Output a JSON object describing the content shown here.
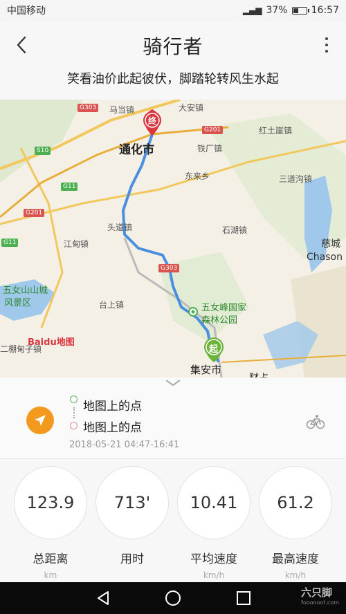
{
  "status_bar": {
    "carrier": "中国移动",
    "battery_percent_text": "37%",
    "battery_level": 0.37,
    "time": "16:57"
  },
  "header": {
    "title": "骑行者",
    "subtitle": "笑看油价此起彼伏，脚踏轮转风生水起"
  },
  "map": {
    "places": [
      "马当镇",
      "大安镇",
      "通化市",
      "铁厂镇",
      "红土崖镇",
      "东来乡",
      "三道沟镇",
      "头道镇",
      "石湖镇",
      "江甸镇",
      "慈城",
      "Chason",
      "五女山山城",
      "风景区",
      "台上镇",
      "五女峰国家",
      "森林公园",
      "二棚甸子镇",
      "集安市",
      "财占"
    ],
    "roads": [
      "G303",
      "G201",
      "S10",
      "G11",
      "G201",
      "G11",
      "G303"
    ],
    "start_marker": "起",
    "end_marker": "终",
    "provider_logo": "Baidu地图",
    "route_color": "#4a8fe0"
  },
  "route": {
    "start_label": "地图上的点",
    "end_label": "地图上的点",
    "time_range": "2018-05-21 04:47-16:41"
  },
  "stats": [
    {
      "value": "123.9",
      "label": "总距离",
      "unit": "km"
    },
    {
      "value": "713'",
      "label": "用时",
      "unit": ""
    },
    {
      "value": "10.41",
      "label": "平均速度",
      "unit": "km/h"
    },
    {
      "value": "61.2",
      "label": "最高速度",
      "unit": "km/h"
    }
  ],
  "watermark": {
    "text": "六只脚",
    "sub": "foooooot.com"
  },
  "colors": {
    "accent_orange": "#f39a1e",
    "start_green": "#5cb85c",
    "end_red": "#d9363e"
  }
}
